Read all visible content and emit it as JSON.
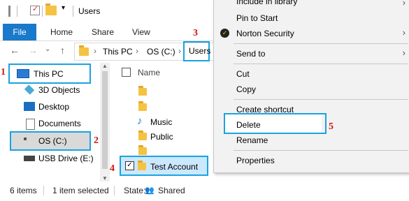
{
  "window": {
    "title": "Users"
  },
  "ribbon": {
    "tabs": [
      "File",
      "Home",
      "Share",
      "View"
    ]
  },
  "address": {
    "crumbs": [
      "This PC",
      "OS (C:)",
      "Users"
    ]
  },
  "nav_pane": {
    "items": [
      {
        "label": "This PC",
        "icon": "monitor-icon"
      },
      {
        "label": "3D Objects",
        "icon": "cube-icon"
      },
      {
        "label": "Desktop",
        "icon": "desktop-icon"
      },
      {
        "label": "Documents",
        "icon": "document-icon"
      },
      {
        "label": "OS (C:)",
        "icon": "drive-icon"
      },
      {
        "label": "USB Drive (E:)",
        "icon": "usb-drive-icon"
      }
    ]
  },
  "file_list": {
    "column_name": "Name",
    "items": [
      {
        "label": "",
        "icon": "folder-icon"
      },
      {
        "label": "",
        "icon": "folder-icon"
      },
      {
        "label": "Music",
        "icon": "music-icon"
      },
      {
        "label": "Public",
        "icon": "folder-icon"
      },
      {
        "label": "",
        "icon": "folder-icon"
      },
      {
        "label": "Test Account",
        "icon": "folder-icon",
        "selected": true
      }
    ]
  },
  "status_bar": {
    "count": "6 items",
    "selected": "1 item selected",
    "state_label": "State:",
    "state_value": "Shared"
  },
  "context_menu": {
    "items": [
      "Include in library",
      "Pin to Start",
      "Norton Security",
      "Send to",
      "Cut",
      "Copy",
      "Create shortcut",
      "Delete",
      "Rename",
      "Properties"
    ]
  },
  "annotations": [
    "1",
    "2",
    "3",
    "4",
    "5"
  ],
  "colors": {
    "accent": "#1979ca",
    "highlight": "#1aa3e0",
    "annotation": "#d01414"
  }
}
